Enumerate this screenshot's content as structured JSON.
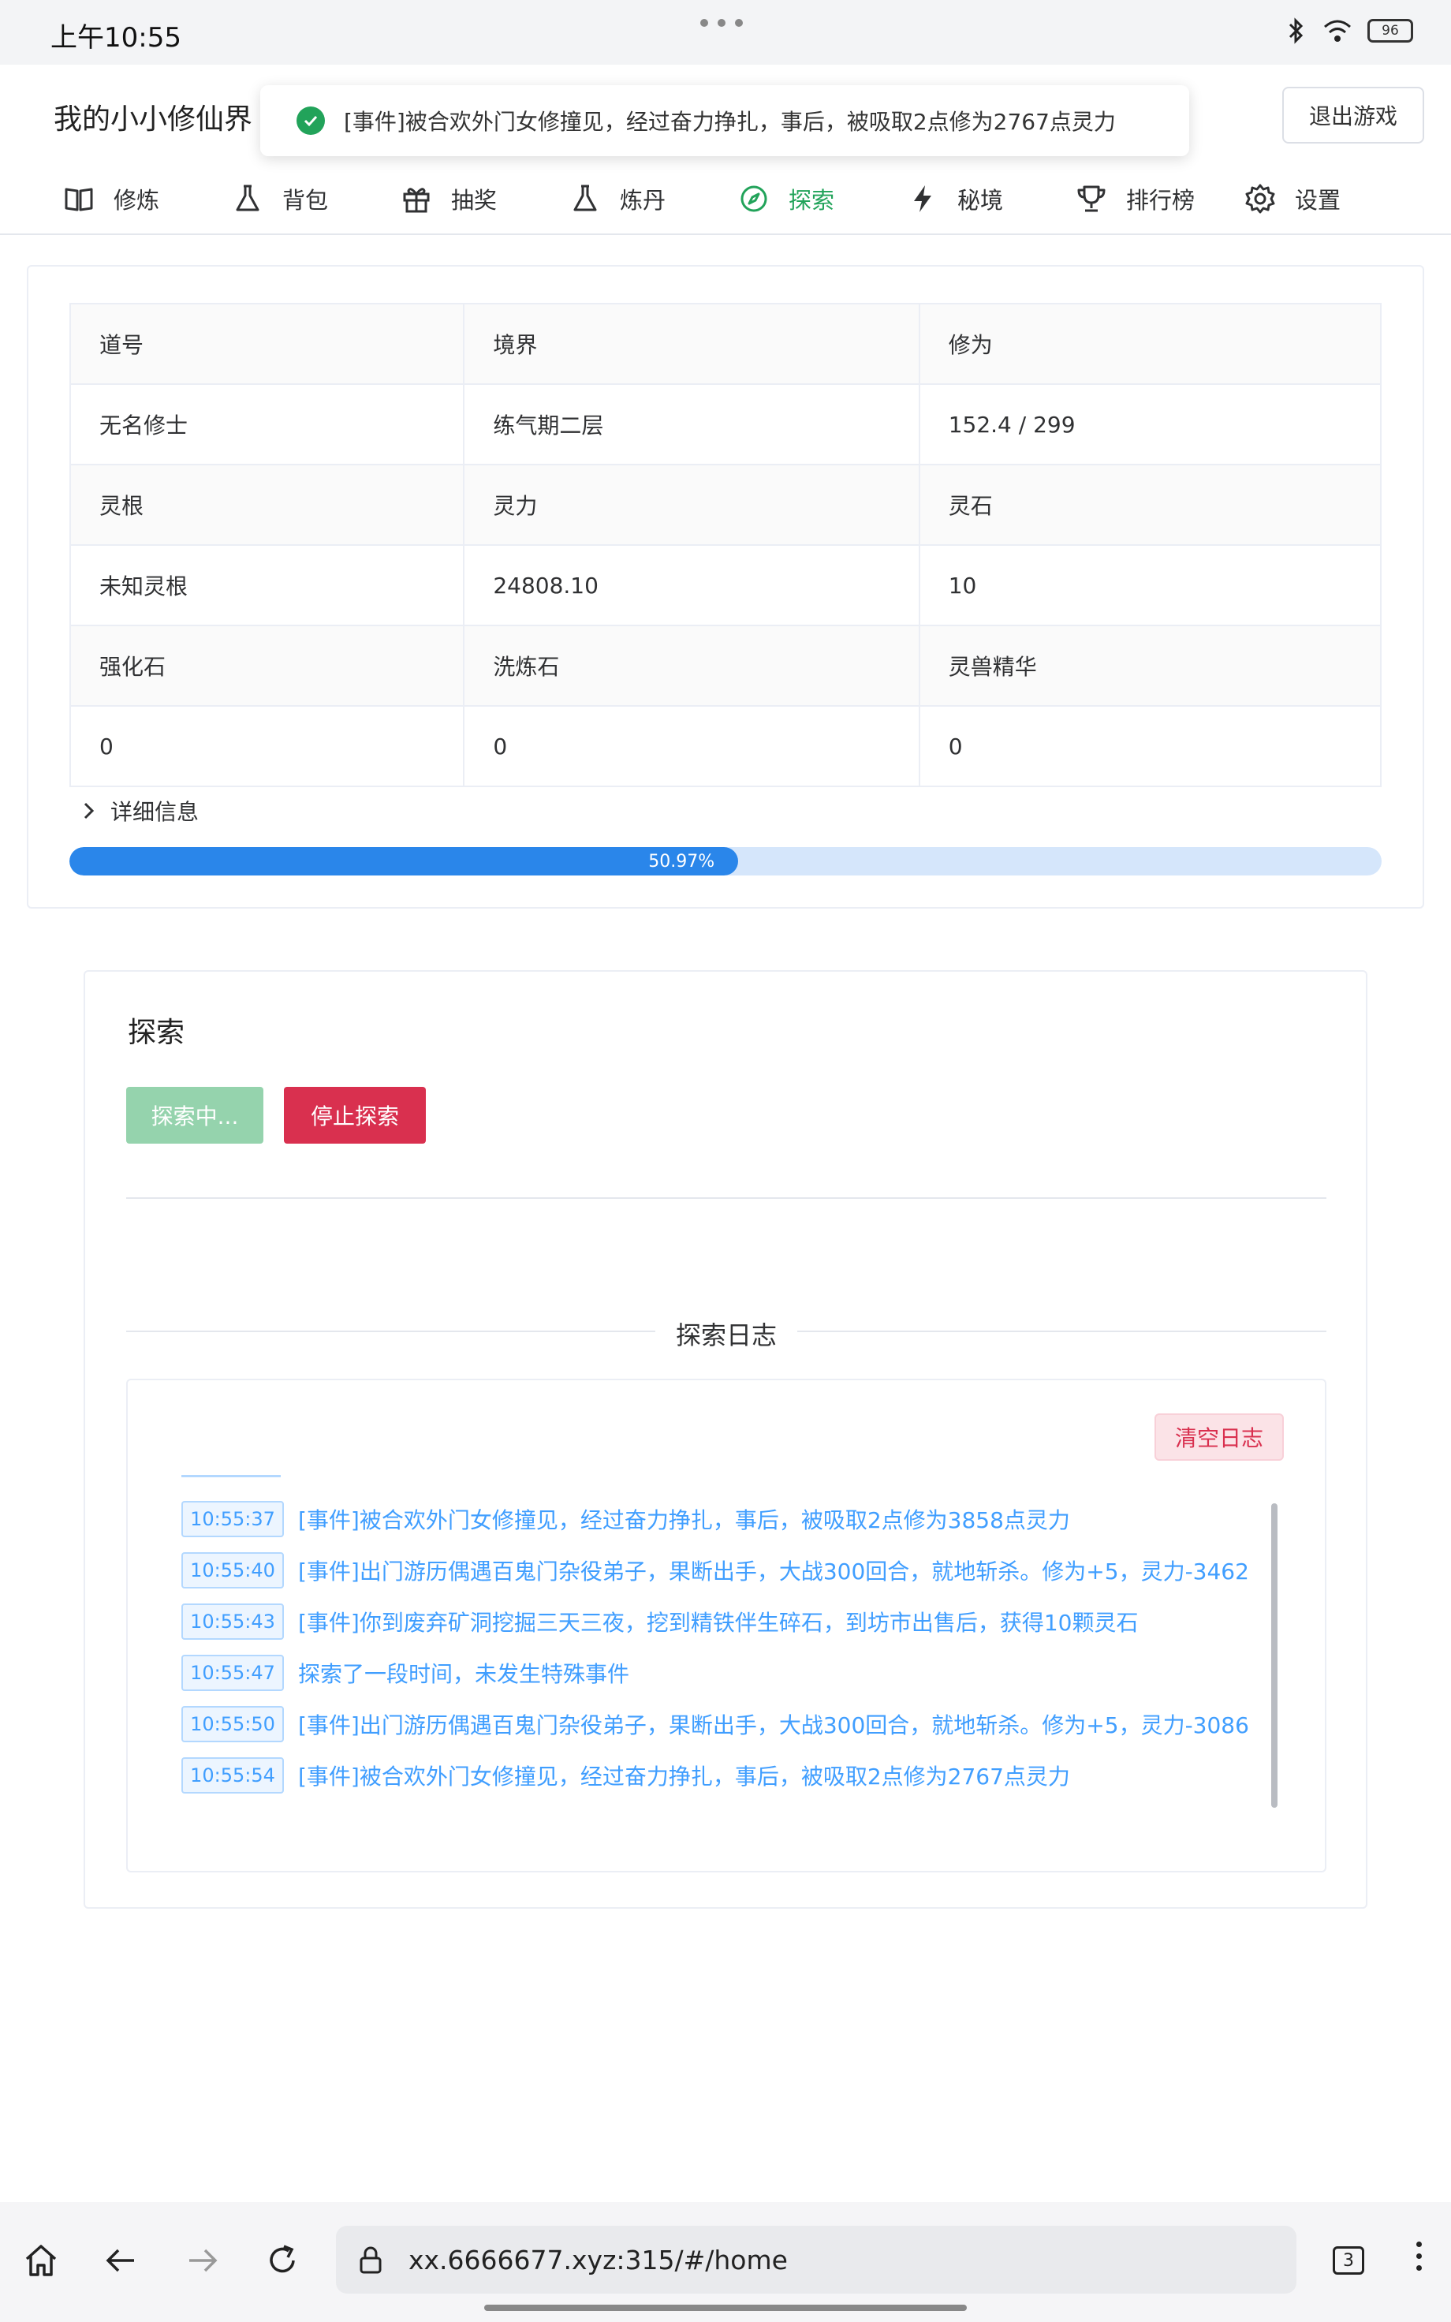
{
  "status_bar": {
    "time": "上午10:55",
    "battery": "96"
  },
  "header": {
    "app_title": "我的小小修仙界",
    "exit_label": "退出游戏"
  },
  "toast": {
    "message": "[事件]被合欢外门女修撞见，经过奋力挣扎，事后，被吸取2点修为2767点灵力"
  },
  "nav": {
    "tabs": [
      {
        "label": "修炼",
        "icon": "book-icon"
      },
      {
        "label": "背包",
        "icon": "flask-icon"
      },
      {
        "label": "抽奖",
        "icon": "gift-icon"
      },
      {
        "label": "炼丹",
        "icon": "flask-icon"
      },
      {
        "label": "探索",
        "icon": "compass-icon",
        "active": true
      },
      {
        "label": "秘境",
        "icon": "lightning-icon"
      },
      {
        "label": "排行榜",
        "icon": "trophy-icon"
      },
      {
        "label": "设置",
        "icon": "gear-icon"
      }
    ],
    "active_color": "#22a35a"
  },
  "stats": {
    "rows": [
      [
        "道号",
        "境界",
        "修为"
      ],
      [
        "无名修士",
        "练气期二层",
        "152.4 / 299"
      ],
      [
        "灵根",
        "灵力",
        "灵石"
      ],
      [
        "未知灵根",
        "24808.10",
        "10"
      ],
      [
        "强化石",
        "洗炼石",
        "灵兽精华"
      ],
      [
        "0",
        "0",
        "0"
      ]
    ],
    "detail_label": "详细信息",
    "progress_percent": 50.97,
    "progress_label": "50.97%"
  },
  "explore": {
    "title": "探索",
    "exploring_label": "探索中...",
    "stop_label": "停止探索",
    "log_title": "探索日志",
    "clear_label": "清空日志",
    "logs": [
      {
        "time": "10:55:37",
        "text": "[事件]被合欢外门女修撞见，经过奋力挣扎，事后，被吸取2点修为3858点灵力"
      },
      {
        "time": "10:55:40",
        "text": "[事件]出门游历偶遇百鬼门杂役弟子，果断出手，大战300回合，就地斩杀。修为+5，灵力-3462"
      },
      {
        "time": "10:55:43",
        "text": "[事件]你到废弃矿洞挖掘三天三夜，挖到精铁伴生碎石，到坊市出售后，获得10颗灵石"
      },
      {
        "time": "10:55:47",
        "text": "探索了一段时间，未发生特殊事件"
      },
      {
        "time": "10:55:50",
        "text": "[事件]出门游历偶遇百鬼门杂役弟子，果断出手，大战300回合，就地斩杀。修为+5，灵力-3086"
      },
      {
        "time": "10:55:54",
        "text": "[事件]被合欢外门女修撞见，经过奋力挣扎，事后，被吸取2点修为2767点灵力"
      }
    ]
  },
  "browser": {
    "url": "xx.6666677.xyz:315/#/home",
    "tab_count": "3"
  },
  "colors": {
    "primary": "#409eff",
    "success": "#22a35a",
    "danger": "#d9304f",
    "progress": "#2a86ea"
  }
}
